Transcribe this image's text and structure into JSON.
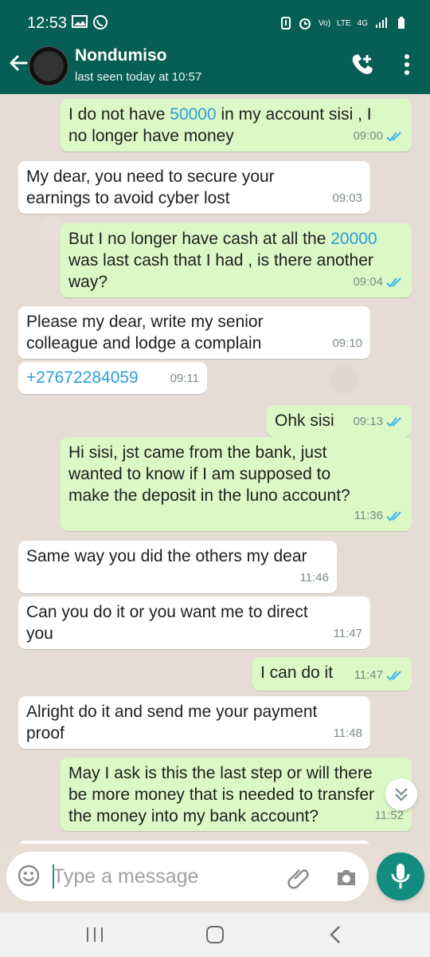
{
  "status": {
    "time": "12:53",
    "vol": "Vo)",
    "lte": "LTE",
    "network": "4G"
  },
  "chat": {
    "name": "Nondumiso",
    "last_seen": "last seen today at 10:57"
  },
  "messages": [
    {
      "text_pre": "I do not have ",
      "amount": "50000",
      "text_post": " in my account sisi , I\nno longer have money",
      "time": "09:00"
    },
    {
      "text": "My dear, you need to secure your\nearnings to avoid cyber lost",
      "time": "09:03"
    },
    {
      "text_pre": "But I no longer have cash at all the ",
      "amount": "20000",
      "text_post": "\nwas last cash that I had , is there another\nway?",
      "time": "09:04"
    },
    {
      "text": "Please my dear, write my senior\ncolleague and lodge a complain",
      "time": "09:10"
    },
    {
      "phone": "+27672284059",
      "time": "09:11"
    },
    {
      "text": "Ohk sisi",
      "time": "09:13"
    },
    {
      "text": "Hi sisi, jst came from the bank, just\nwanted to know if I am supposed to\nmake the deposit in the luno account?",
      "time": "11:36"
    },
    {
      "text": "Same way you did the others my dear",
      "time": "11:46"
    },
    {
      "text": "Can you do it or you want me to direct\nyou",
      "time": "11:47"
    },
    {
      "text": "I can do it",
      "time": "11:47"
    },
    {
      "text": "Alright do it and send me your payment\nproof",
      "time": "11:48"
    },
    {
      "text": "May I ask is this the last step or will there\nbe more money that is needed to transfer\nthe money into my bank account?",
      "time": "11:52"
    }
  ],
  "composer": {
    "placeholder": "Type a message"
  },
  "colors": {
    "header": "#075e54",
    "sent_bubble": "#dcf8c6",
    "received_bubble": "#ffffff",
    "read_ticks": "#34b7f1",
    "mic_button": "#128c7e"
  },
  "icons": {
    "back": "back-arrow-icon",
    "call": "add-call-icon",
    "menu": "more-vertical-icon",
    "emoji": "emoji-icon",
    "attach": "paperclip-icon",
    "camera": "camera-icon",
    "mic": "microphone-icon"
  }
}
